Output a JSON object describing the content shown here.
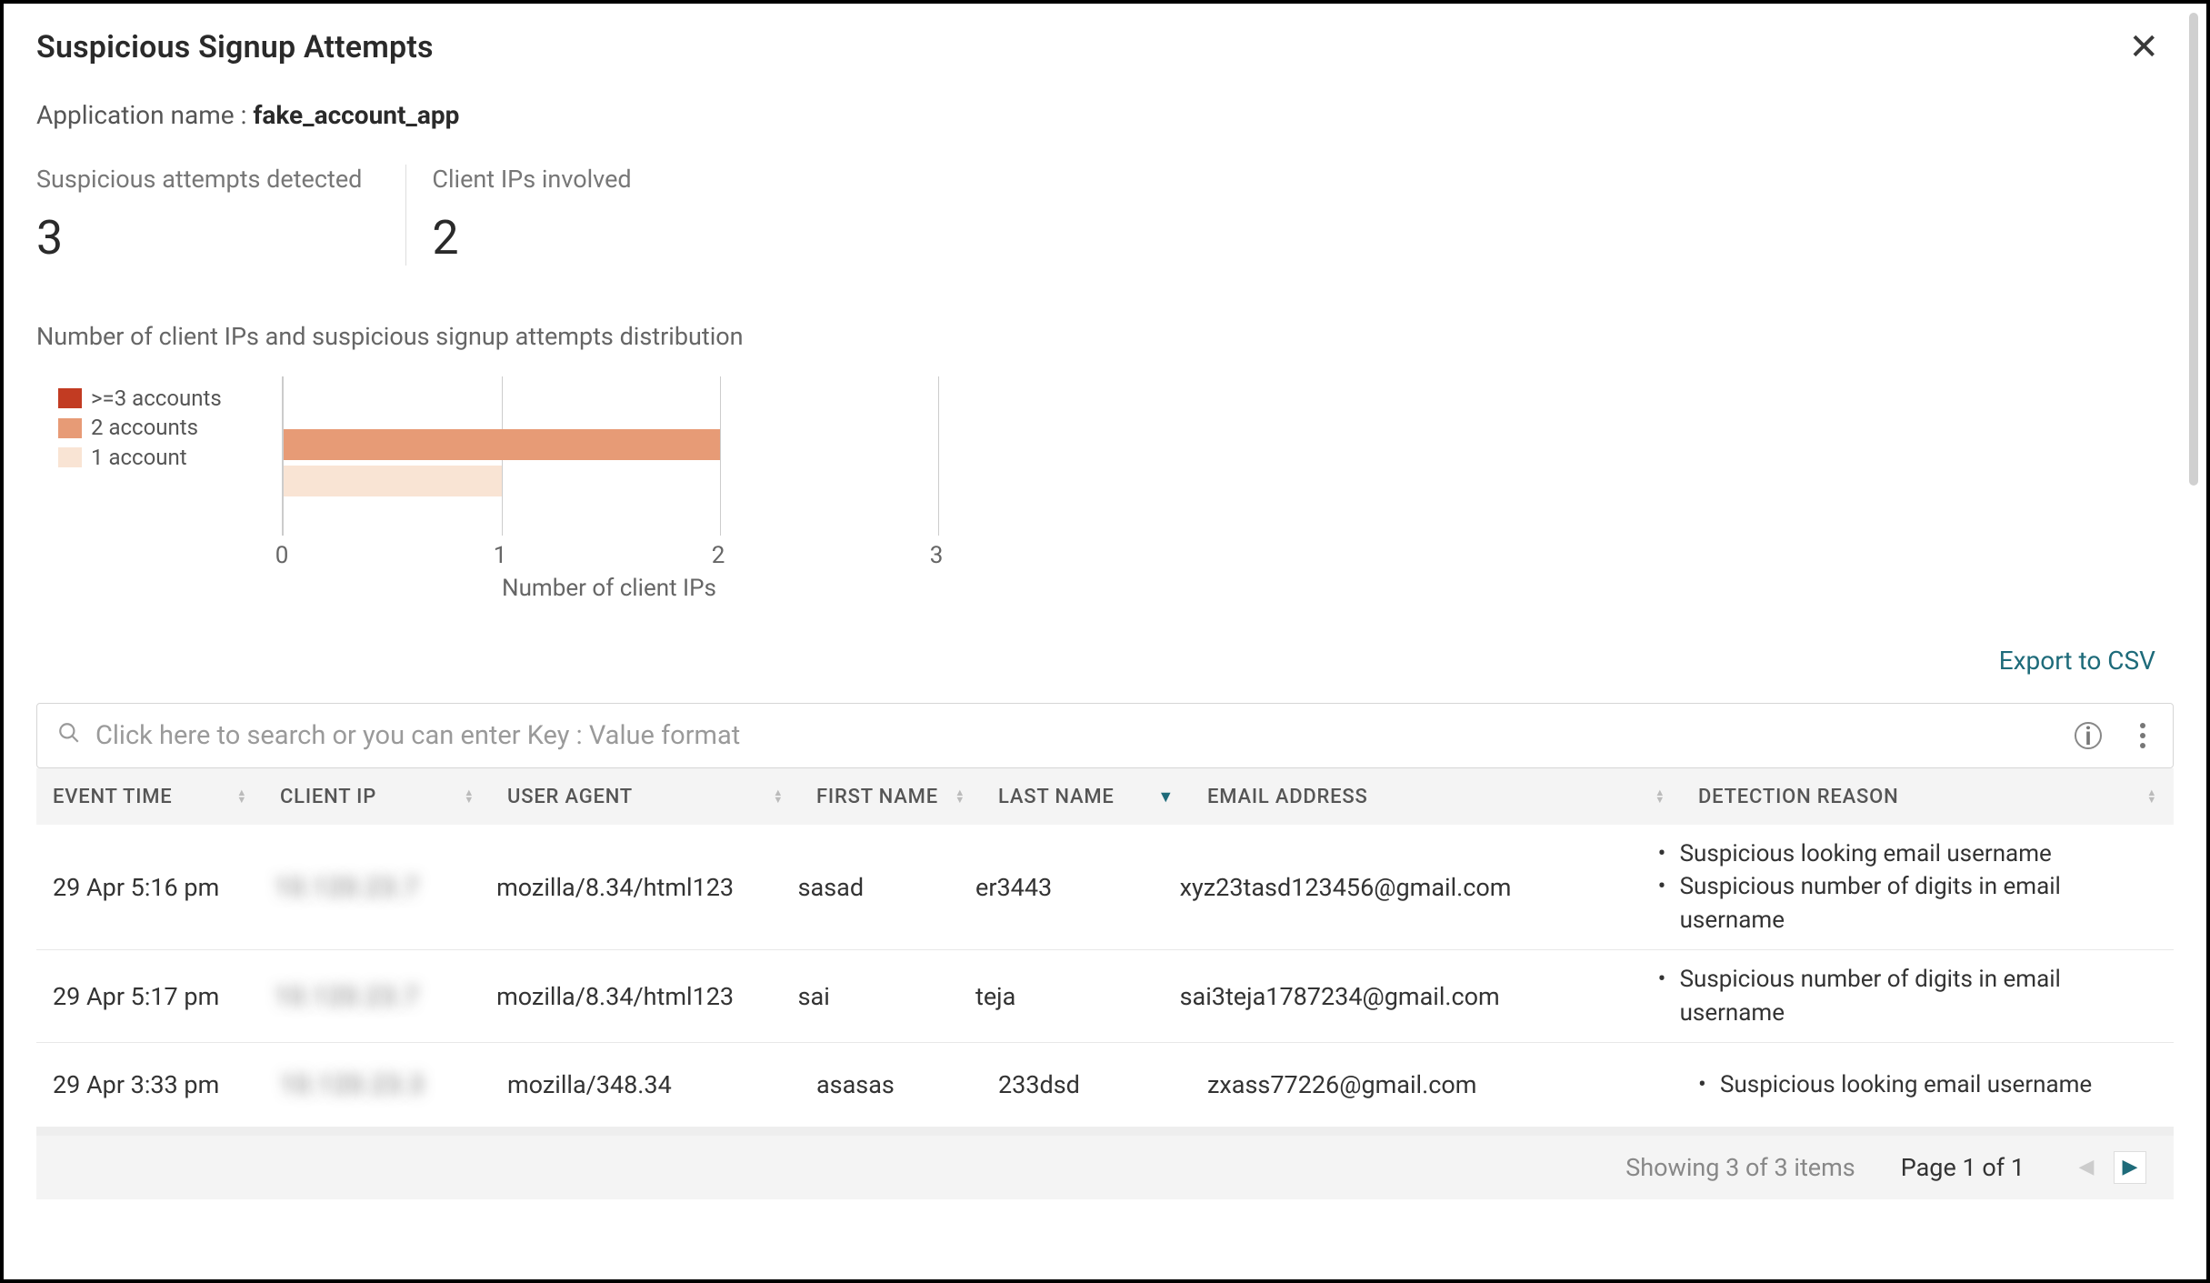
{
  "header": {
    "title": "Suspicious Signup Attempts"
  },
  "app": {
    "label": "Application name :",
    "value": "fake_account_app"
  },
  "metrics": [
    {
      "label": "Suspicious attempts detected",
      "value": "3"
    },
    {
      "label": "Client IPs involved",
      "value": "2"
    }
  ],
  "chart_section_title": "Number of client IPs and suspicious signup attempts distribution",
  "legend": [
    {
      "label": ">=3 accounts",
      "color": "#c23b22"
    },
    {
      "label": "2 accounts",
      "color": "#e79b76"
    },
    {
      "label": "1 account",
      "color": "#f9e4d4"
    }
  ],
  "chart_data": {
    "type": "bar",
    "orientation": "horizontal",
    "series": [
      {
        "name": "2 accounts",
        "color": "#e79b76",
        "values": [
          2
        ]
      },
      {
        "name": "1 account",
        "color": "#f9e4d4",
        "values": [
          1
        ]
      }
    ],
    "xlabel": "Number of client IPs",
    "xlim": [
      0,
      3
    ],
    "xticks": [
      0,
      1,
      2,
      3
    ]
  },
  "export_label": "Export to CSV",
  "search": {
    "placeholder": "Click here to search or you can enter Key : Value format"
  },
  "columns": {
    "event_time": "EVENT TIME",
    "client_ip": "CLIENT IP",
    "user_agent": "USER AGENT",
    "first_name": "FIRST NAME",
    "last_name": "LAST NAME",
    "email": "EMAIL ADDRESS",
    "reason": "DETECTION REASON"
  },
  "rows": [
    {
      "event_time": "29 Apr 5:16 pm",
      "client_ip": "10.120.23.7",
      "user_agent": "mozilla/8.34/html123",
      "first_name": "sasad",
      "last_name": "er3443",
      "email": "xyz23tasd123456@gmail.com",
      "reasons": [
        "Suspicious looking email username",
        "Suspicious number of digits in email username"
      ]
    },
    {
      "event_time": "29 Apr 5:17 pm",
      "client_ip": "10.120.23.7",
      "user_agent": "mozilla/8.34/html123",
      "first_name": "sai",
      "last_name": "teja",
      "email": "sai3teja1787234@gmail.com",
      "reasons": [
        "Suspicious number of digits in email username"
      ]
    },
    {
      "event_time": "29 Apr 3:33 pm",
      "client_ip": "10.120.23.3",
      "user_agent": "mozilla/348.34",
      "first_name": "asasas",
      "last_name": "233dsd",
      "email": "zxass77226@gmail.com",
      "reasons": [
        "Suspicious looking email username"
      ]
    }
  ],
  "footer": {
    "showing": "Showing 3 of 3 items",
    "page": "Page 1 of 1"
  }
}
